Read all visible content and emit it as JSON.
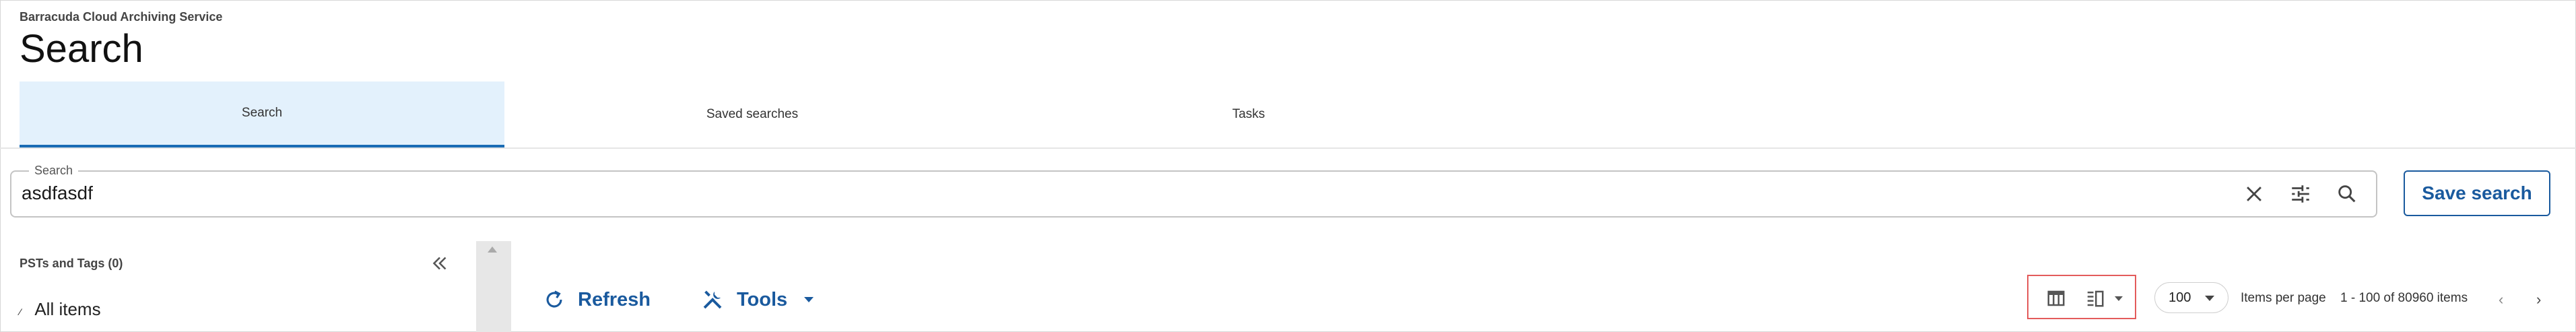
{
  "app": {
    "name": "Barracuda Cloud Archiving Service",
    "title": "Search"
  },
  "tabs": [
    {
      "label": "Search",
      "active": true
    },
    {
      "label": "Saved searches",
      "active": false
    },
    {
      "label": "Tasks",
      "active": false
    }
  ],
  "search": {
    "legend": "Search",
    "value": "asdfasdf",
    "placeholder": ""
  },
  "actions": {
    "save_label": "Save search"
  },
  "left_panel": {
    "title": "PSTs and Tags (0)",
    "all_items": "All items"
  },
  "toolbar": {
    "refresh_label": "Refresh",
    "tools_label": "Tools"
  },
  "pagination": {
    "per_page_value": "100",
    "per_page_label": "Items per page",
    "range": "1 - 100 of 80960 items",
    "prev": "‹",
    "next": "›"
  },
  "colors": {
    "accent": "#1a5a9e",
    "tab_active_bg": "#e3f1fc",
    "tab_active_border": "#1a6cb4",
    "highlight_box": "#e35b5b"
  },
  "icons": [
    "clear-icon",
    "filter-sliders-icon",
    "search-icon",
    "collapse-left-icon",
    "refresh-icon",
    "tools-icon",
    "dropdown-caret-icon",
    "table-view-icon",
    "reading-pane-view-icon"
  ]
}
